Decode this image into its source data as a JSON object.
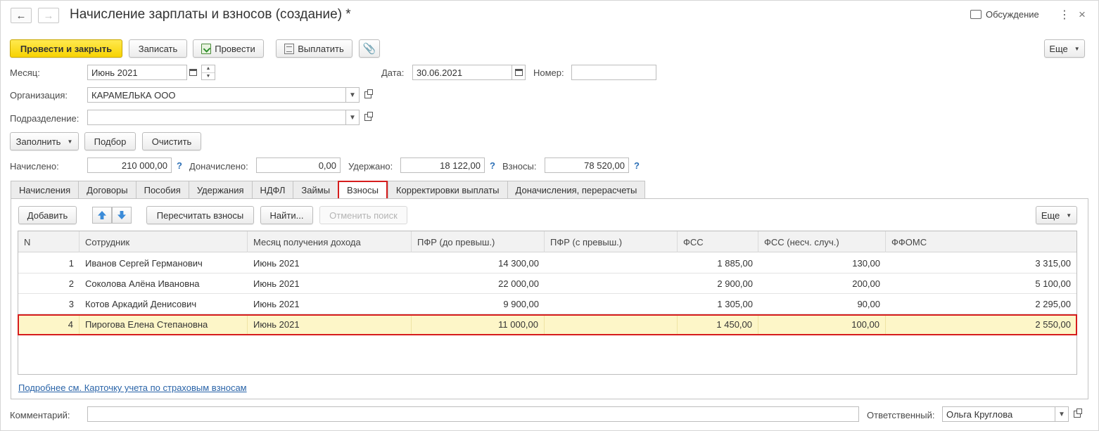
{
  "window": {
    "title": "Начисление зарплаты и взносов (создание) *",
    "back_icon": "←",
    "forward_icon": "→",
    "discuss_label": "Обсуждение",
    "more_icon": "⋮",
    "close_icon": "×"
  },
  "toolbar": {
    "post_close": "Провести и закрыть",
    "save": "Записать",
    "post": "Провести",
    "pay": "Выплатить",
    "more": "Еще"
  },
  "header": {
    "month_label": "Месяц:",
    "month_value": "Июнь 2021",
    "date_label": "Дата:",
    "date_value": "30.06.2021",
    "number_label": "Номер:",
    "number_value": "",
    "org_label": "Организация:",
    "org_value": "КАРАМЕЛЬКА ООО",
    "dept_label": "Подразделение:",
    "dept_value": ""
  },
  "fill_bar": {
    "fill": "Заполнить",
    "pick": "Подбор",
    "clear": "Очистить"
  },
  "totals": {
    "accrued_label": "Начислено:",
    "accrued_value": "210 000,00",
    "extra_label": "Доначислено:",
    "extra_value": "0,00",
    "withheld_label": "Удержано:",
    "withheld_value": "18 122,00",
    "contrib_label": "Взносы:",
    "contrib_value": "78 520,00",
    "help": "?"
  },
  "tabs": [
    {
      "label": "Начисления"
    },
    {
      "label": "Договоры"
    },
    {
      "label": "Пособия"
    },
    {
      "label": "Удержания"
    },
    {
      "label": "НДФЛ"
    },
    {
      "label": "Займы"
    },
    {
      "label": "Взносы"
    },
    {
      "label": "Корректировки выплаты"
    },
    {
      "label": "Доначисления, перерасчеты"
    }
  ],
  "active_tab": "Взносы",
  "panel_toolbar": {
    "add": "Добавить",
    "recalc": "Пересчитать взносы",
    "find": "Найти...",
    "cancel_search": "Отменить поиск",
    "more": "Еще"
  },
  "table": {
    "columns": [
      "N",
      "Сотрудник",
      "Месяц получения дохода",
      "ПФР (до превыш.)",
      "ПФР (с превыш.)",
      "ФСС",
      "ФСС (несч. случ.)",
      "ФФОМС"
    ],
    "rows": [
      [
        "1",
        "Иванов Сергей Германович",
        "Июнь 2021",
        "14 300,00",
        "",
        "1 885,00",
        "130,00",
        "3 315,00"
      ],
      [
        "2",
        "Соколова Алёна Ивановна",
        "Июнь 2021",
        "22 000,00",
        "",
        "2 900,00",
        "200,00",
        "5 100,00"
      ],
      [
        "3",
        "Котов Аркадий Денисович",
        "Июнь 2021",
        "9 900,00",
        "",
        "1 305,00",
        "90,00",
        "2 295,00"
      ],
      [
        "4",
        "Пирогова Елена Степановна",
        "Июнь 2021",
        "11 000,00",
        "",
        "1 450,00",
        "100,00",
        "2 550,00"
      ]
    ],
    "selected_row": 4
  },
  "footer": {
    "details_link": "Подробнее см. Карточку учета по страховым взносам",
    "comment_label": "Комментарий:",
    "comment_value": "",
    "responsible_label": "Ответственный:",
    "responsible_value": "Ольга Круглова"
  },
  "colors": {
    "accent_yellow": "#f7d302",
    "highlight_red": "#d61d1d",
    "selected_row_bg": "#fdf6c8",
    "link_blue": "#2a64a8"
  }
}
